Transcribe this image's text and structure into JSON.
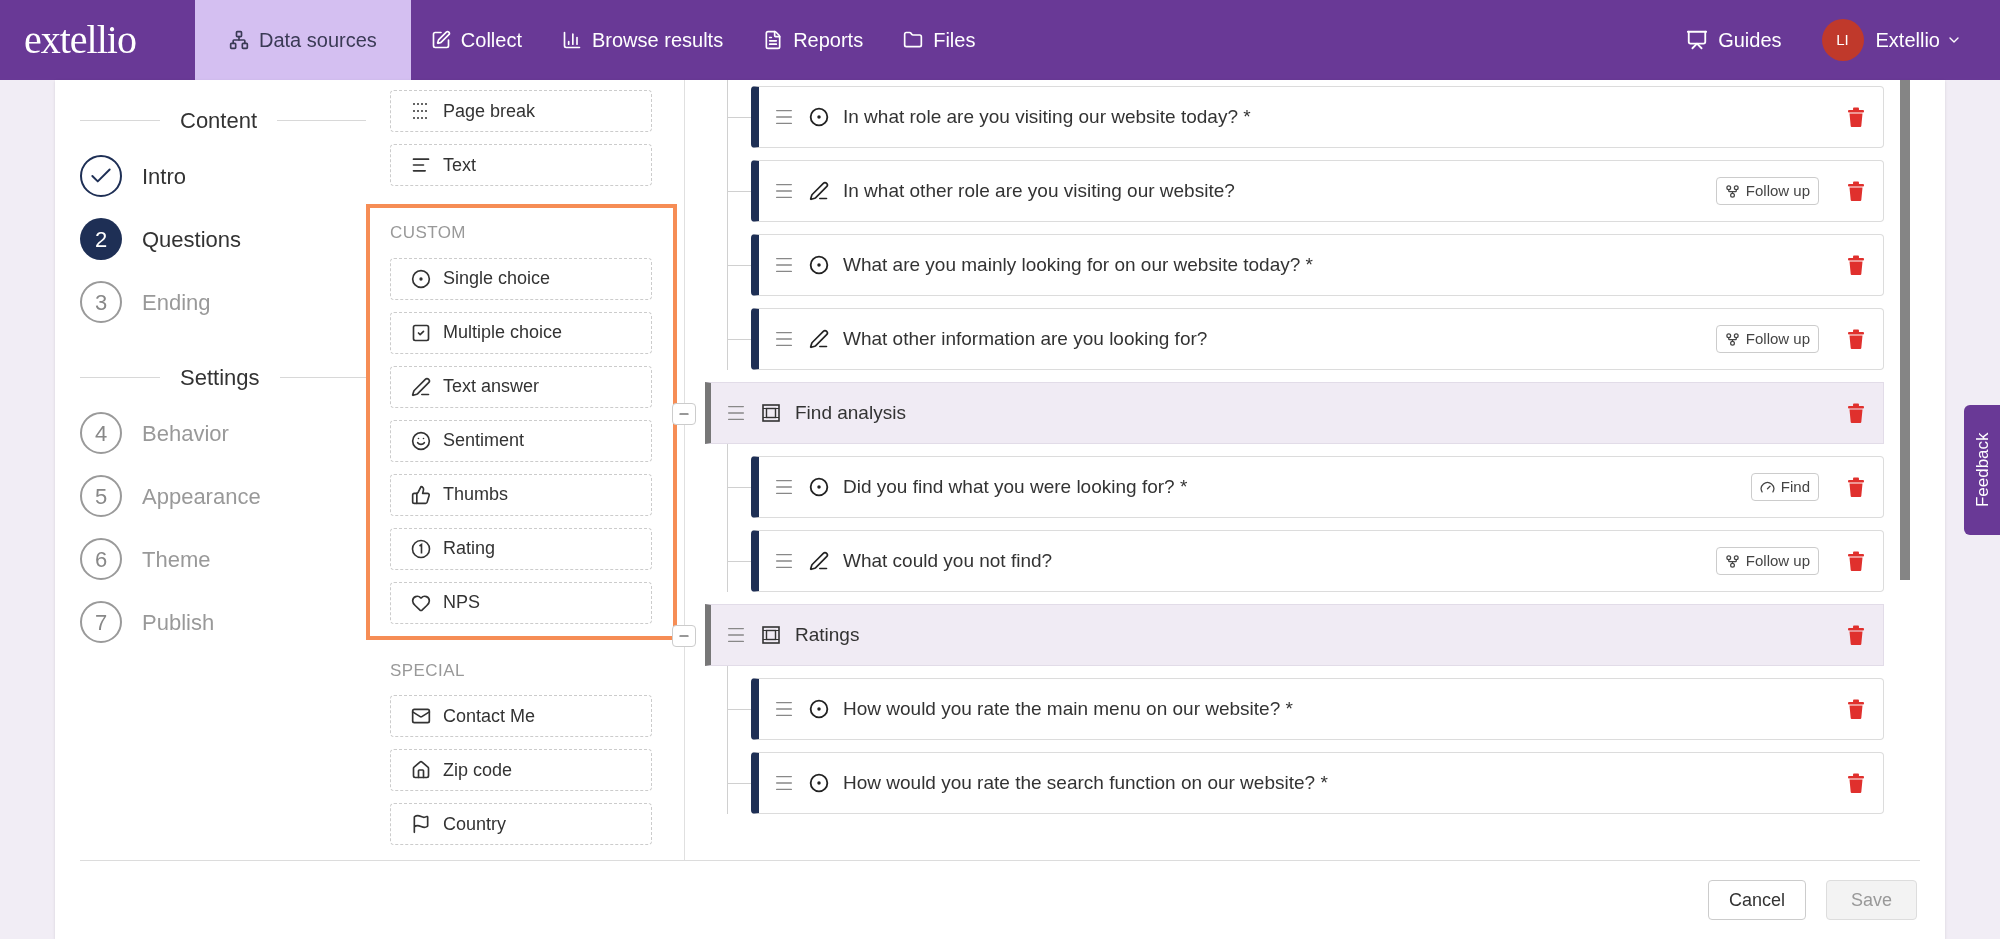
{
  "nav": {
    "logo": "extellio",
    "tabs": [
      {
        "kind": "data_sources",
        "label": "Data sources",
        "selected": true
      },
      {
        "kind": "collect",
        "label": "Collect",
        "selected": false
      },
      {
        "kind": "browse",
        "label": "Browse results",
        "selected": false
      },
      {
        "kind": "reports",
        "label": "Reports",
        "selected": false
      },
      {
        "kind": "files",
        "label": "Files",
        "selected": false
      }
    ],
    "guides": "Guides",
    "user": {
      "initials": "LI",
      "name": "Extellio"
    }
  },
  "steps": [
    {
      "title": "Content",
      "items": [
        {
          "label": "Intro",
          "kind": "done"
        },
        {
          "number": "2",
          "label": "Questions",
          "kind": "current"
        },
        {
          "number": "3",
          "label": "Ending",
          "kind": "upcoming"
        }
      ]
    },
    {
      "title": "Settings",
      "items": [
        {
          "number": "4",
          "label": "Behavior",
          "kind": "upcoming"
        },
        {
          "number": "5",
          "label": "Appearance",
          "kind": "upcoming"
        },
        {
          "number": "6",
          "label": "Theme",
          "kind": "upcoming"
        },
        {
          "number": "7",
          "label": "Publish",
          "kind": "upcoming"
        }
      ]
    }
  ],
  "palette": [
    {
      "highlighted": false,
      "items": [
        {
          "kind": "page_break",
          "label": "Page break"
        },
        {
          "kind": "text",
          "label": "Text"
        }
      ]
    },
    {
      "title": "CUSTOM",
      "highlighted": true,
      "items": [
        {
          "kind": "single",
          "label": "Single choice"
        },
        {
          "kind": "multiple",
          "label": "Multiple choice"
        },
        {
          "kind": "text_answer",
          "label": "Text answer"
        },
        {
          "kind": "sentiment",
          "label": "Sentiment"
        },
        {
          "kind": "thumbs",
          "label": "Thumbs"
        },
        {
          "kind": "rating",
          "label": "Rating"
        },
        {
          "kind": "nps",
          "label": "NPS"
        }
      ]
    },
    {
      "title": "SPECIAL",
      "highlighted": false,
      "items": [
        {
          "kind": "contact",
          "label": "Contact Me"
        },
        {
          "kind": "zip",
          "label": "Zip code"
        },
        {
          "kind": "country",
          "label": "Country"
        }
      ]
    }
  ],
  "questions": [
    {
      "kind": "single",
      "text": "In what role are you visiting our website today? *"
    },
    {
      "kind": "text",
      "text": "In what other role are you visiting our website?",
      "badge": {
        "kind": "follow_up",
        "label": "Follow up"
      }
    },
    {
      "kind": "single",
      "text": "What are you mainly looking for on our website today? *"
    },
    {
      "kind": "text",
      "text": "What other information are you looking for?",
      "badge": {
        "kind": "follow_up",
        "label": "Follow up"
      }
    }
  ],
  "groups": [
    {
      "title": "Find analysis",
      "expanded": true,
      "children": [
        {
          "kind": "single",
          "text": "Did you find what you were looking for? *",
          "badge": {
            "kind": "find",
            "label": "Find"
          }
        },
        {
          "kind": "text",
          "text": "What could you not find?",
          "badge": {
            "kind": "follow_up",
            "label": "Follow up"
          }
        }
      ]
    },
    {
      "title": "Ratings",
      "expanded": true,
      "children": [
        {
          "kind": "single",
          "text": "How would you rate the main menu on our website? *"
        },
        {
          "kind": "single",
          "text": "How would you rate the search function on our website? *"
        }
      ]
    }
  ],
  "footer": {
    "cancel": "Cancel",
    "save": {
      "label": "Save",
      "disabled": true
    }
  },
  "feedback": "Feedback"
}
